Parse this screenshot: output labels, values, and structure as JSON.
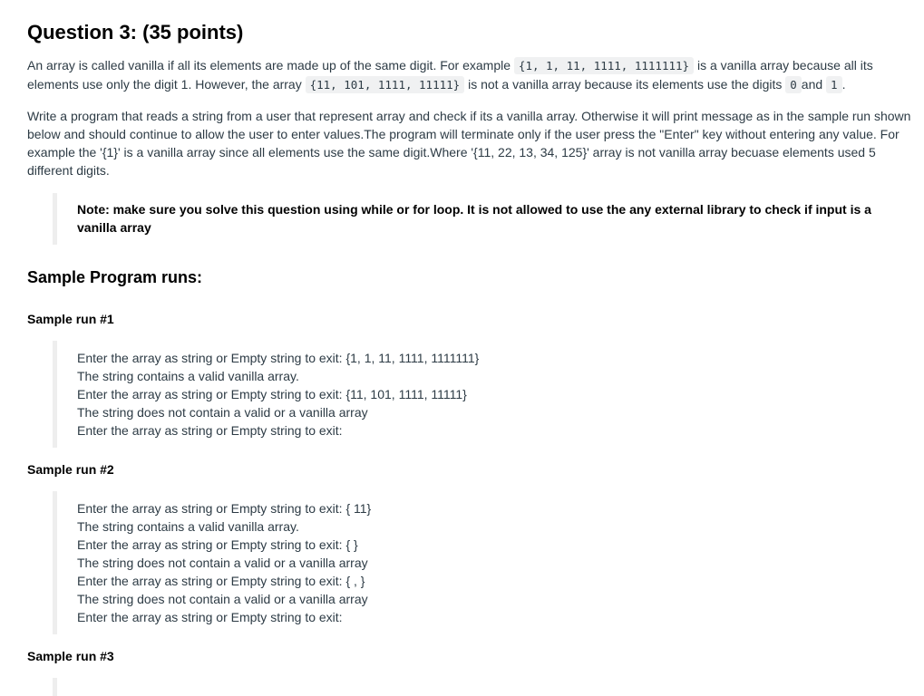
{
  "question": {
    "title": "Question 3: (35 points)"
  },
  "intro": {
    "p1_a": "An array is called vanilla if all its elements are made up of the same digit. For example",
    "p1_code1": "{1, 1, 11, 1111, 1111111}",
    "p1_b": "is a vanilla array because all its elements use only the digit 1. However, the array",
    "p1_code2": "{11, 101, 1111, 11111}",
    "p1_c": "is not a vanilla array because its elements use the digits",
    "p1_code3": "0",
    "p1_d": "and",
    "p1_code4": "1",
    "p1_e": ".",
    "p2": "Write a program that reads a string from a user that represent array and check if its a vanilla array. Otherwise it will print message as in the sample run shown below and should continue to allow the user to enter values.The program will terminate only if the user press the \"Enter\" key without entering any value. For example the '{1}' is a vanilla array since all elements use the same digit.Where '{11, 22, 13, 34, 125}' array is not vanilla array becuase elements used 5 different digits."
  },
  "note": {
    "text": "Note: make sure you solve this question using while or for loop. It is not allowed to use the any external library to check if input is a vanilla array"
  },
  "samples": {
    "heading": "Sample Program runs:",
    "runs": [
      {
        "title": "Sample run #1",
        "lines": [
          "Enter the array as string or Empty string to exit: {1, 1, 11, 1111, 1111111}",
          "The string contains a valid vanilla array.",
          "Enter the array as string or Empty string to exit: {11, 101, 1111, 11111}",
          "The string does not contain a valid or a vanilla array",
          "Enter the array as string or Empty string to exit:"
        ]
      },
      {
        "title": "Sample run #2",
        "lines": [
          "Enter the array as string or Empty string to exit: { 11}",
          "The string contains a valid vanilla array.",
          "Enter the array as string or Empty string to exit: { }",
          "The string does not contain a valid or a vanilla array",
          "Enter the array as string or Empty string to exit: { , }",
          "The string does not contain a valid or a vanilla array",
          "Enter the array as string or Empty string to exit:"
        ]
      },
      {
        "title": "Sample run #3",
        "lines": []
      }
    ]
  }
}
